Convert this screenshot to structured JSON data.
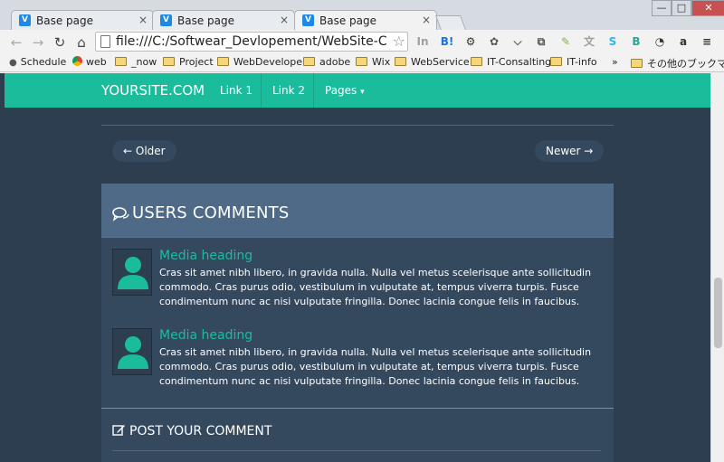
{
  "browser": {
    "tabs": [
      {
        "title": "Base page",
        "favicon": "v-icon"
      },
      {
        "title": "Base page",
        "favicon": "v-icon"
      },
      {
        "title": "Base page",
        "favicon": "v-icon"
      }
    ],
    "tab_close_glyph": "×",
    "window_controls": {
      "minimize": "—",
      "maximize": "□",
      "close": "✕"
    },
    "url": "file:///C:/Softwear_Devlopement/WebSite-Catal",
    "star_glyph": "☆",
    "extensions": [
      {
        "name": "in-icon",
        "glyph": "In",
        "color": "#9e9e9e"
      },
      {
        "name": "hatena-bookmark-icon",
        "glyph": "B!",
        "color": "#1a73e8"
      },
      {
        "name": "gear-icon",
        "glyph": "⚙",
        "color": "#333333"
      },
      {
        "name": "stamp-icon",
        "glyph": "✿",
        "color": "#555555"
      },
      {
        "name": "pocket-icon",
        "glyph": "⌵",
        "color": "#555555"
      },
      {
        "name": "cast-icon",
        "glyph": "⧉",
        "color": "#555555"
      },
      {
        "name": "evernote-icon",
        "glyph": "✎",
        "color": "#7cb342"
      },
      {
        "name": "translate-icon",
        "glyph": "文",
        "color": "#9e9e9e"
      },
      {
        "name": "skype-icon",
        "glyph": "S",
        "color": "#29b6f6"
      },
      {
        "name": "b-icon",
        "glyph": "B",
        "color": "#26a69a"
      },
      {
        "name": "clock-icon",
        "glyph": "◔",
        "color": "#333333"
      },
      {
        "name": "amazon-icon",
        "glyph": "a",
        "color": "#333333"
      },
      {
        "name": "menu-icon",
        "glyph": "≡",
        "color": "#333333"
      }
    ],
    "bookmarks": [
      {
        "label": "Schedule",
        "type": "apple-icon"
      },
      {
        "label": "web",
        "type": "chrome-icon"
      },
      {
        "label": "_now",
        "type": "folder-icon"
      },
      {
        "label": "Project",
        "type": "folder-icon"
      },
      {
        "label": "WebDeveloper",
        "type": "folder-icon"
      },
      {
        "label": "adobe",
        "type": "folder-icon"
      },
      {
        "label": "Wix",
        "type": "folder-icon"
      },
      {
        "label": "WebService",
        "type": "folder-icon"
      },
      {
        "label": "IT-Consalting",
        "type": "folder-icon"
      },
      {
        "label": "IT-info",
        "type": "folder-icon"
      }
    ],
    "bookmarks_overflow": "»",
    "other_bookmarks": "その他のブックマーク"
  },
  "site": {
    "brand": "YOURSITE.COM",
    "nav": [
      "Link 1",
      "Link 2",
      "Pages"
    ],
    "pages_caret": "▾",
    "accent": "#1abc9c",
    "background": "#2c3e50"
  },
  "pager": {
    "older": "← Older",
    "newer": "Newer →"
  },
  "comments": {
    "title": "USERS COMMENTS",
    "items": [
      {
        "heading": "Media heading",
        "body": "Cras sit amet nibh libero, in gravida nulla. Nulla vel metus scelerisque ante sollicitudin commodo. Cras purus odio, vestibulum in vulputate at, tempus viverra turpis. Fusce condimentum nunc ac nisi vulputate fringilla. Donec lacinia congue felis in faucibus."
      },
      {
        "heading": "Media heading",
        "body": "Cras sit amet nibh libero, in gravida nulla. Nulla vel metus scelerisque ante sollicitudin commodo. Cras purus odio, vestibulum in vulputate at, tempus viverra turpis. Fusce condimentum nunc ac nisi vulputate fringilla. Donec lacinia congue felis in faucibus."
      }
    ]
  },
  "post": {
    "title": "POST YOUR COMMENT"
  }
}
